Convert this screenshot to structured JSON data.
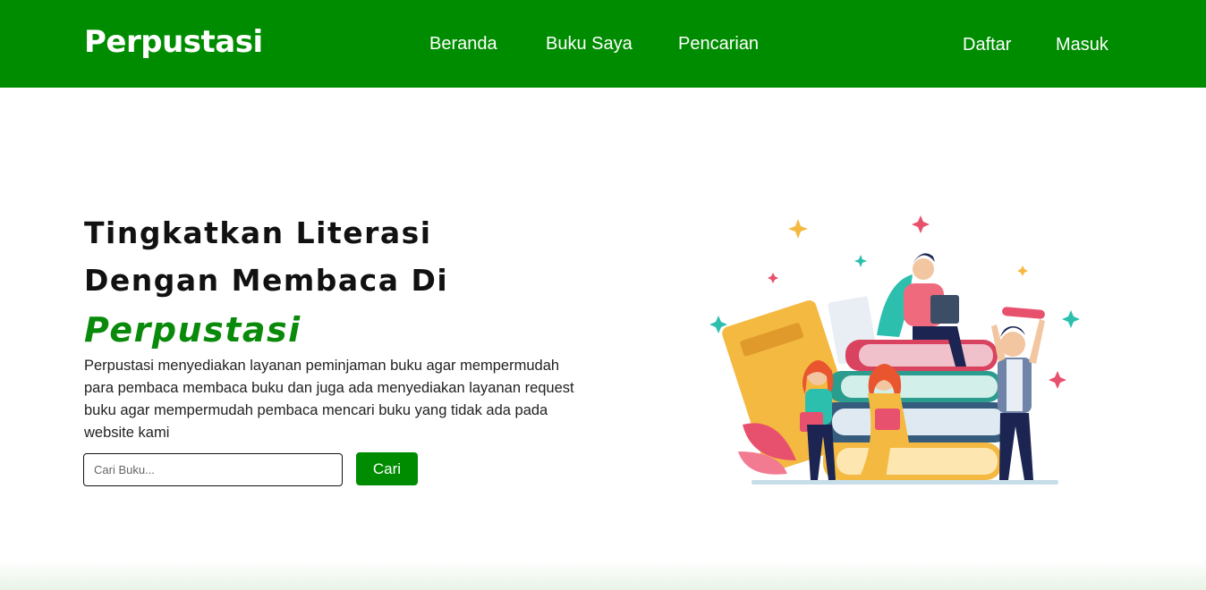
{
  "header": {
    "brand": "Perpustasi",
    "nav": [
      "Beranda",
      "Buku Saya",
      "Pencarian"
    ],
    "auth": {
      "register": "Daftar",
      "login": "Masuk"
    },
    "background_color": "#008c00"
  },
  "hero": {
    "title_line1": "Tingkatkan Literasi",
    "title_line2": "Dengan Membaca Di",
    "title_accent": "Perpustasi",
    "accent_color": "#0a8a0a",
    "description": "Perpustasi menyediakan layanan peminjaman buku agar mempermudah para pembaca membaca buku dan juga ada menyediakan layanan request buku agar mempermudah pembaca mencari buku yang tidak ada pada website kami"
  },
  "search": {
    "placeholder": "Cari Buku...",
    "value": "",
    "button_label": "Cari"
  },
  "illustration": {
    "icon": "people-reading-books-illustration"
  }
}
